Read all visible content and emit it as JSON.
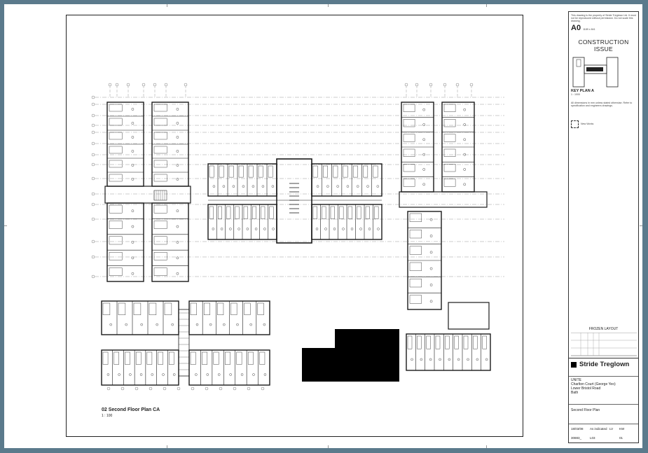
{
  "sheet": {
    "note": "This drawing is the property of Stride Treglown Ltd. It must not be reproduced without permission. Do not scale this drawing.",
    "size": "A0",
    "size_note": "1189 x 841",
    "status": "CONSTRUCTION ISSUE",
    "key_plan_label": "KEY PLAN A",
    "key_plan_scale": "1 : 1000",
    "notes_small": "All dimensions in mm unless stated otherwise. Refer to specification and engineers drawings.",
    "legend_note": "New Works",
    "frozen_layout": "FROZEN LAYOUT",
    "practice": "Stride Treglown",
    "client": "UNITE",
    "project_line1": "Charlton Court (George Yeo)",
    "project_line2": "Lower Bristol Road",
    "project_line3": "Bath",
    "drawing_title": "Second Floor Plan",
    "scale_value": "As indicated",
    "drawn": "LV",
    "checked": "KW",
    "date": "18/03/08",
    "project_no": "30883_",
    "drawing_no": "L03",
    "revision": "01"
  },
  "plan": {
    "title": "02 Second Floor Plan CA",
    "scale": "1 : 100"
  },
  "colors": {
    "background": "#5b7a8c",
    "sheet": "#ffffff",
    "ink": "#1a1a1a",
    "grid": "#555555"
  }
}
